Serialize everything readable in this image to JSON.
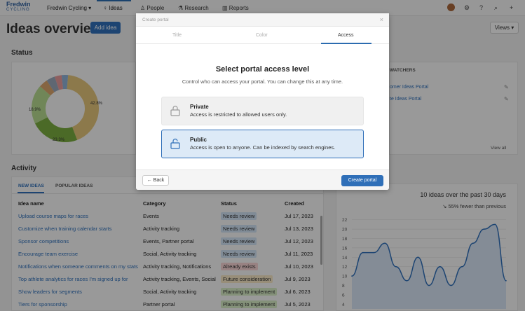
{
  "topbar": {
    "logo_line1": "Fredwin",
    "logo_line2": "CYCLING",
    "workspace": "Fredwin Cycling ▾",
    "nav": [
      "Ideas",
      "People",
      "Research",
      "Reports"
    ]
  },
  "page": {
    "title": "Ideas overview",
    "add_idea": "Add idea",
    "views": "Views ▾"
  },
  "status": {
    "title": "Status",
    "pct_left": "18.9%",
    "pct_right": "42.8%",
    "pct_bottom": "23.3%"
  },
  "portals": {
    "header": "WATCHERS",
    "items": [
      "omer Ideas Portal",
      "te Ideas Portal"
    ],
    "view_all": "View all"
  },
  "activity": {
    "title": "Activity",
    "tabs": [
      "NEW IDEAS",
      "POPULAR IDEAS"
    ],
    "columns": [
      "Idea name",
      "Category",
      "Status",
      "Created"
    ],
    "rows": [
      {
        "name": "Upload course maps for races",
        "category": "Events",
        "status": "Needs review",
        "created": "Jul 17, 2023"
      },
      {
        "name": "Customize when training calendar starts",
        "category": "Activity tracking",
        "status": "Needs review",
        "created": "Jul 13, 2023"
      },
      {
        "name": "Sponsor competitions",
        "category": "Events, Partner portal",
        "status": "Needs review",
        "created": "Jul 12, 2023"
      },
      {
        "name": "Encourage team exercise",
        "category": "Social, Activity tracking",
        "status": "Needs review",
        "created": "Jul 11, 2023"
      },
      {
        "name": "Notifications when someone comments on my stats",
        "category": "Activity tracking, Notifications",
        "status": "Already exists",
        "created": "Jul 10, 2023"
      },
      {
        "name": "Top athlete analytics for races I'm signed up for",
        "category": "Activity tracking, Events, Social",
        "status": "Future consideration",
        "created": "Jul 9, 2023"
      },
      {
        "name": "Show leaders for segments",
        "category": "Social, Activity tracking",
        "status": "Planning to implement",
        "created": "Jul 6, 2023"
      },
      {
        "name": "Tiers for sponsorship",
        "category": "Partner portal",
        "status": "Planning to implement",
        "created": "Jul 5, 2023"
      }
    ],
    "status_colors": {
      "Needs review": "#cfe0f2",
      "Already exists": "#f6d2d2",
      "Future consideration": "#f5e6c4",
      "Planning to implement": "#d6ebc4"
    }
  },
  "trend": {
    "title": "10 ideas over the past 30 days",
    "subtitle": "↘ 55% fewer than previous"
  },
  "chart_data": {
    "type": "area",
    "yticks": [
      4,
      6,
      8,
      10,
      12,
      14,
      16,
      18,
      20,
      22
    ],
    "ylim": [
      3,
      23
    ],
    "values": [
      10,
      15,
      15,
      17,
      12,
      9,
      14,
      8,
      12,
      8,
      12,
      17,
      20,
      21,
      9
    ],
    "color": "#2f6fb8"
  },
  "modal": {
    "window_title": "Create portal",
    "tabs": [
      "Title",
      "Color",
      "Access"
    ],
    "active_tab": "Access",
    "heading": "Select portal access level",
    "subheading": "Control who can access your portal. You can change this at any time.",
    "private": {
      "name": "Private",
      "desc": "Access is restricted to allowed users only."
    },
    "public": {
      "name": "Public",
      "desc": "Access is open to anyone. Can be indexed by search engines."
    },
    "back": "← Back",
    "create": "Create portal"
  }
}
